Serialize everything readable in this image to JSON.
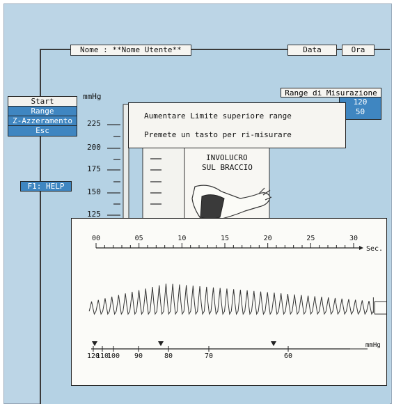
{
  "header": {
    "name_field": "Nome : **Nome Utente**",
    "date_button": "Data",
    "time_button": "Ora"
  },
  "menu": {
    "title": "Start",
    "items": [
      "Range",
      "Z-Azzeramento",
      "Esc"
    ]
  },
  "help_button": "F1: HELP",
  "gauge": {
    "unit": "mmHg",
    "ticks": [
      "225",
      "200",
      "175",
      "150",
      "125"
    ]
  },
  "range_panel": {
    "title": "Range di Misurazione",
    "values": [
      "120",
      "50"
    ]
  },
  "dialog": {
    "line1": "Aumentare Limite superiore range",
    "line2": "Premete un tasto per ri-misurare"
  },
  "cuff_instruction": {
    "line1": "INVOLUCRO",
    "line2": "SUL BRACCIO"
  },
  "chart_data": {
    "type": "line",
    "x_axis": {
      "ticks": [
        "00",
        "05",
        "10",
        "15",
        "20",
        "25",
        "30"
      ],
      "unit": "Sec.",
      "range": [
        0,
        30
      ]
    },
    "pressure_axis": {
      "ticks": [
        "120",
        "110",
        "100",
        "90",
        "80",
        "70",
        "60"
      ],
      "unit": "mmHg"
    },
    "markers_mmHg": [
      120,
      84,
      62
    ],
    "oscillation": {
      "cycles": 42,
      "start_sec": -0.8,
      "end_sec": 32.3,
      "peak_at_sec": 8
    }
  },
  "colors": {
    "background": "#b5d2e4",
    "panel": "#f6f5f1",
    "accent": "#3f86c1"
  }
}
